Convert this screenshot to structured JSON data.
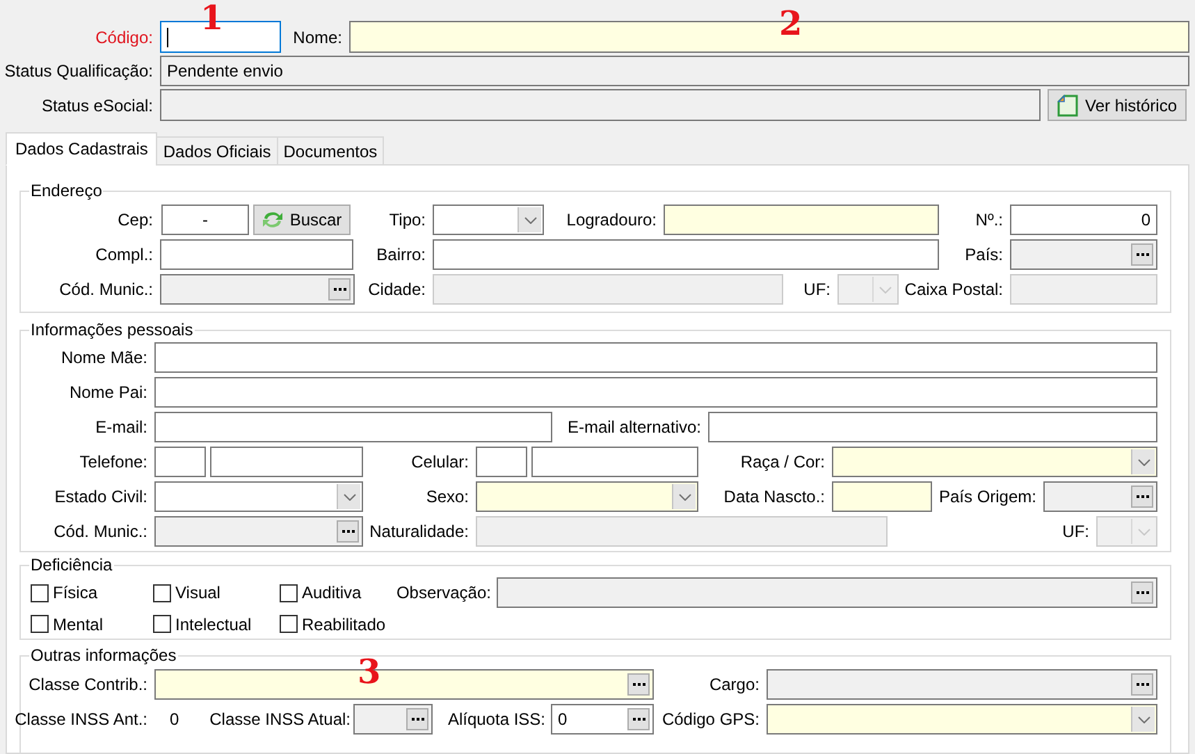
{
  "header": {
    "rows": [
      {
        "items": [
          {
            "kind": "label",
            "text": "Código:",
            "required": true
          },
          {
            "kind": "field",
            "required": false,
            "read_only": false,
            "disabled": false,
            "focused": true
          },
          {
            "kind": "label",
            "text": "Nome:",
            "required": false
          },
          {
            "kind": "field",
            "required": true,
            "read_only": false,
            "disabled": false,
            "focused": false
          }
        ]
      },
      {
        "items": [
          {
            "kind": "label",
            "text": "Status Qualificação:",
            "required": false
          },
          {
            "kind": "field",
            "required": false,
            "read_only": true,
            "disabled": false,
            "value": "Pendente envio",
            "focused": false
          }
        ]
      },
      {
        "items": [
          {
            "kind": "label",
            "text": "Status eSocial:",
            "required": false
          },
          {
            "kind": "field",
            "required": false,
            "read_only": true,
            "disabled": false,
            "focused": false
          },
          {
            "kind": "button",
            "label": "Ver histórico"
          }
        ]
      }
    ]
  },
  "tabs": [
    {
      "label": "Dados Cadastrais",
      "selected": true
    },
    {
      "label": "Dados Oficiais",
      "selected": false
    },
    {
      "label": "Documentos",
      "selected": false
    }
  ],
  "groups": [
    {
      "title": "Endereço",
      "rows": [
        {
          "items": [
            {
              "kind": "label",
              "text": "Cep:"
            },
            {
              "kind": "field",
              "required": false,
              "read_only": false,
              "disabled": false,
              "value": "-"
            },
            {
              "kind": "button",
              "label": "Buscar"
            },
            {
              "kind": "label",
              "text": "Tipo:"
            },
            {
              "kind": "combo",
              "required": false,
              "read_only": false,
              "disabled": false
            },
            {
              "kind": "label",
              "text": "Logradouro:"
            },
            {
              "kind": "field",
              "required": true,
              "read_only": false,
              "disabled": false
            },
            {
              "kind": "label",
              "text": "Nº.:"
            },
            {
              "kind": "field",
              "required": false,
              "read_only": false,
              "disabled": false,
              "value": "0"
            }
          ]
        },
        {
          "items": [
            {
              "kind": "label",
              "text": "Compl.:"
            },
            {
              "kind": "field",
              "required": false,
              "read_only": false,
              "disabled": false
            },
            {
              "kind": "label",
              "text": "Bairro:"
            },
            {
              "kind": "field",
              "required": false,
              "read_only": false,
              "disabled": false
            },
            {
              "kind": "label",
              "text": "País:"
            },
            {
              "kind": "lookup",
              "required": false,
              "read_only": true,
              "disabled": false
            }
          ]
        },
        {
          "items": [
            {
              "kind": "label",
              "text": "Cód. Munic.:"
            },
            {
              "kind": "lookup",
              "required": false,
              "read_only": true,
              "disabled": false
            },
            {
              "kind": "label",
              "text": "Cidade:"
            },
            {
              "kind": "field",
              "required": false,
              "read_only": true,
              "disabled": true
            },
            {
              "kind": "label",
              "text": "UF:"
            },
            {
              "kind": "combo",
              "required": false,
              "read_only": true,
              "disabled": true
            },
            {
              "kind": "label",
              "text": "Caixa Postal:"
            },
            {
              "kind": "field",
              "required": false,
              "read_only": true,
              "disabled": true
            }
          ]
        }
      ]
    },
    {
      "title": "Informações pessoais",
      "rows": [
        {
          "items": [
            {
              "kind": "label",
              "text": "Nome Mãe:"
            },
            {
              "kind": "field",
              "required": false,
              "read_only": false,
              "disabled": false
            }
          ]
        },
        {
          "items": [
            {
              "kind": "label",
              "text": "Nome Pai:"
            },
            {
              "kind": "field",
              "required": false,
              "read_only": false,
              "disabled": false
            }
          ]
        },
        {
          "items": [
            {
              "kind": "label",
              "text": "E-mail:"
            },
            {
              "kind": "field",
              "required": false,
              "read_only": false,
              "disabled": false
            },
            {
              "kind": "label",
              "text": "E-mail alternativo:"
            },
            {
              "kind": "field",
              "required": false,
              "read_only": false,
              "disabled": false
            }
          ]
        },
        {
          "items": [
            {
              "kind": "label",
              "text": "Telefone:"
            },
            {
              "kind": "field",
              "required": false,
              "read_only": false,
              "disabled": false
            },
            {
              "kind": "field",
              "required": false,
              "read_only": false,
              "disabled": false
            },
            {
              "kind": "label",
              "text": "Celular:"
            },
            {
              "kind": "field",
              "required": false,
              "read_only": false,
              "disabled": false
            },
            {
              "kind": "field",
              "required": false,
              "read_only": false,
              "disabled": false
            },
            {
              "kind": "label",
              "text": "Raça / Cor:"
            },
            {
              "kind": "combo",
              "required": true,
              "read_only": false,
              "disabled": false
            }
          ]
        },
        {
          "items": [
            {
              "kind": "label",
              "text": "Estado Civil:"
            },
            {
              "kind": "combo",
              "required": false,
              "read_only": false,
              "disabled": false
            },
            {
              "kind": "label",
              "text": "Sexo:"
            },
            {
              "kind": "combo",
              "required": true,
              "read_only": false,
              "disabled": false
            },
            {
              "kind": "label",
              "text": "Data Nascto.:"
            },
            {
              "kind": "field",
              "required": true,
              "read_only": false,
              "disabled": false
            },
            {
              "kind": "label",
              "text": "País Origem:"
            },
            {
              "kind": "lookup",
              "required": false,
              "read_only": true,
              "disabled": false
            }
          ]
        },
        {
          "items": [
            {
              "kind": "label",
              "text": "Cód. Munic.:"
            },
            {
              "kind": "lookup",
              "required": false,
              "read_only": true,
              "disabled": false
            },
            {
              "kind": "label",
              "text": "Naturalidade:"
            },
            {
              "kind": "field",
              "required": false,
              "read_only": true,
              "disabled": true
            },
            {
              "kind": "label",
              "text": "UF:"
            },
            {
              "kind": "combo",
              "required": false,
              "read_only": true,
              "disabled": true
            }
          ]
        }
      ]
    },
    {
      "title": "Deficiência",
      "rows": [
        {
          "items": [
            {
              "kind": "checkbox",
              "label": "Física",
              "checked": false
            },
            {
              "kind": "checkbox",
              "label": "Visual",
              "checked": false
            },
            {
              "kind": "checkbox",
              "label": "Auditiva",
              "checked": false
            },
            {
              "kind": "label",
              "text": "Observação:"
            },
            {
              "kind": "lookup",
              "required": false,
              "read_only": true,
              "disabled": false
            }
          ]
        },
        {
          "items": [
            {
              "kind": "checkbox",
              "label": "Mental",
              "checked": false
            },
            {
              "kind": "checkbox",
              "label": "Intelectual",
              "checked": false
            },
            {
              "kind": "checkbox",
              "label": "Reabilitado",
              "checked": false
            }
          ]
        }
      ]
    },
    {
      "title": "Outras informações",
      "rows": [
        {
          "items": [
            {
              "kind": "label",
              "text": "Classe Contrib.:"
            },
            {
              "kind": "lookup",
              "required": true,
              "read_only": false,
              "disabled": false
            },
            {
              "kind": "label",
              "text": "Cargo:"
            },
            {
              "kind": "lookup",
              "required": false,
              "read_only": true,
              "disabled": false
            }
          ]
        },
        {
          "items": [
            {
              "kind": "label",
              "text": "Classe INSS Ant.:"
            },
            {
              "kind": "text",
              "text": "0"
            },
            {
              "kind": "label",
              "text": "Classe INSS Atual:"
            },
            {
              "kind": "lookup",
              "required": false,
              "read_only": true,
              "disabled": false
            },
            {
              "kind": "label",
              "text": "Alíquota ISS:"
            },
            {
              "kind": "lookup",
              "required": false,
              "read_only": false,
              "disabled": false,
              "value": "0"
            },
            {
              "kind": "label",
              "text": "Código GPS:"
            },
            {
              "kind": "combo",
              "required": true,
              "read_only": false,
              "disabled": false
            }
          ]
        }
      ]
    }
  ],
  "annotations": [
    "1",
    "2",
    "3"
  ]
}
